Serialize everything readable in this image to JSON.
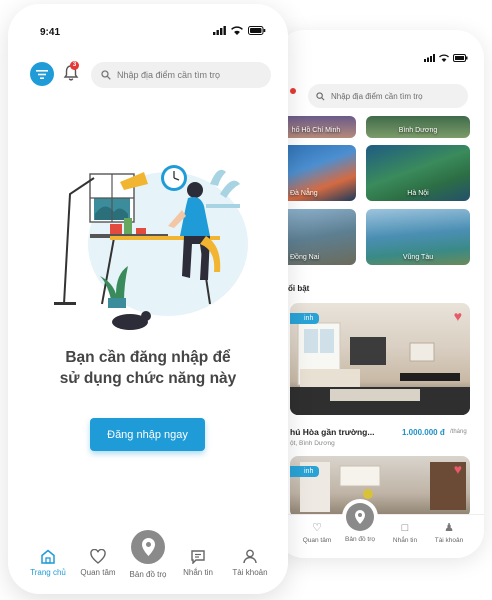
{
  "front": {
    "status": {
      "time": "9:41"
    },
    "notification_count": "3",
    "search_placeholder": "Nhập địa điểm cần tìm trọ",
    "login_message_line1": "Bạn cần đăng nhập để",
    "login_message_line2": "sử dụng chức năng này",
    "login_button": "Đăng nhập ngay",
    "nav": {
      "home": "Trang chủ",
      "favorites": "Quan tâm",
      "map": "Bản đồ trọ",
      "messages": "Nhắn tin",
      "account": "Tài khoản"
    }
  },
  "back": {
    "search_placeholder": "Nhập địa điểm cần tìm trọ",
    "cities": [
      "hố Hồ Chí Minh",
      "Bình Dương",
      "Đà Nẵng",
      "Hà Nội",
      "Đồng Nai",
      "Vũng Tàu"
    ],
    "section_title": "ổi bật",
    "listing": {
      "tag": "inh",
      "title": "hú Hòa gần trường...",
      "price": "1.000.000 đ",
      "unit": "/tháng",
      "location": "ột, Bình Dương"
    },
    "listing2_tag": "inh",
    "nav": {
      "favorites": "Quan tâm",
      "map": "Bản đồ trọ",
      "messages": "Nhắn tin",
      "account": "Tài khoản"
    }
  },
  "colors": {
    "accent": "#1f9bd7",
    "price": "#1f8fc7",
    "badge": "#e53935",
    "heart": "#e85a6a"
  },
  "icons": [
    "filter-icon",
    "bell-icon",
    "search-icon",
    "home-icon",
    "heart-icon",
    "map-pin-icon",
    "chat-icon",
    "user-icon",
    "signal-icon",
    "wifi-icon",
    "battery-icon"
  ]
}
